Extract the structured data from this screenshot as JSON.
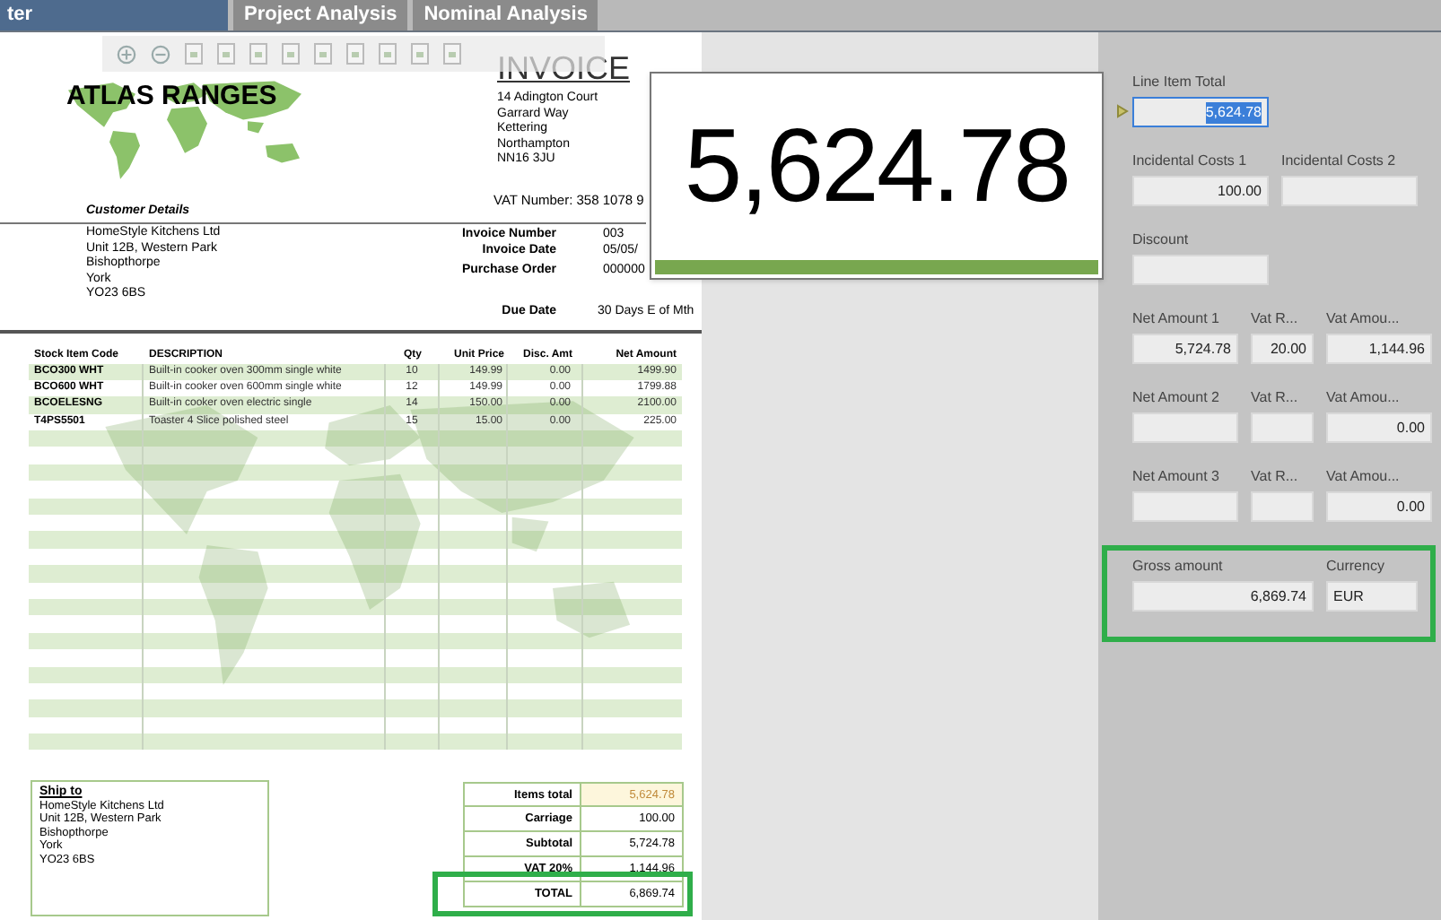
{
  "tabs": [
    {
      "label": "ter",
      "selected": true
    },
    {
      "label": "Project Analysis",
      "selected": false
    },
    {
      "label": "Nominal Analysis",
      "selected": false
    }
  ],
  "invoice": {
    "company": "ATLAS RANGES",
    "title": "INVOICE",
    "address": [
      "14 Adington Court",
      "Garrard Way",
      "Kettering",
      "Northampton",
      "NN16 3JU"
    ],
    "vat_number": "VAT Number: 358 1078 9",
    "customer_heading": "Customer Details",
    "customer": [
      "HomeStyle Kitchens Ltd",
      "Unit 12B, Western Park",
      "Bishopthorpe",
      "York",
      "YO23 6BS"
    ],
    "meta": [
      {
        "label": "Invoice Number",
        "value": "003"
      },
      {
        "label": "Invoice Date",
        "value": "05/05/"
      },
      {
        "label": "Purchase Order",
        "value": "000000"
      }
    ],
    "due_date": {
      "label": "Due Date",
      "value": "30 Days E of Mth"
    },
    "columns": [
      "Stock Item Code",
      "DESCRIPTION",
      "Qty",
      "Unit Price",
      "Disc. Amt",
      "Net Amount"
    ],
    "rows": [
      [
        "BCO300 WHT",
        "Built-in cooker oven 300mm single white",
        "10",
        "149.99",
        "0.00",
        "1499.90"
      ],
      [
        "BCO600 WHT",
        "Built-in cooker oven 600mm single white",
        "12",
        "149.99",
        "0.00",
        "1799.88"
      ],
      [
        "BCOELESNG",
        "Built-in cooker oven electric single",
        "14",
        "150.00",
        "0.00",
        "2100.00"
      ],
      [
        "T4PS5501",
        "Toaster 4 Slice polished steel",
        "15",
        "15.00",
        "0.00",
        "225.00"
      ]
    ],
    "ship_to_heading": "Ship to",
    "ship_to": [
      "HomeStyle Kitchens Ltd",
      "Unit 12B, Western Park",
      "Bishopthorpe",
      "York",
      "YO23 6BS"
    ],
    "totals": [
      {
        "label": "Items total",
        "value": "5,624.78",
        "highlighted": false,
        "selected": true
      },
      {
        "label": "Carriage",
        "value": "100.00",
        "highlighted": false,
        "selected": false
      },
      {
        "label": "Subtotal",
        "value": "5,724.78",
        "highlighted": false,
        "selected": false
      },
      {
        "label": "VAT 20%",
        "value": "1,144.96",
        "highlighted": false,
        "selected": false
      },
      {
        "label": "TOTAL",
        "value": "6,869.74",
        "highlighted": true,
        "selected": false
      }
    ]
  },
  "popup": {
    "value": "5,624.78"
  },
  "panel": {
    "rows": [
      {
        "fields": [
          {
            "label": "Line Item Total",
            "value": "5,624.78",
            "selected": true
          }
        ]
      },
      {
        "fields": [
          {
            "label": "Incidental Costs 1",
            "value": "100.00",
            "selected": false
          },
          {
            "label": "Incidental Costs 2",
            "selected": false
          }
        ]
      },
      {
        "fields": [
          {
            "label": "Discount",
            "selected": false
          }
        ]
      },
      {
        "fields": [
          {
            "label": "Net Amount 1",
            "value": "5,724.78",
            "selected": false
          },
          {
            "label": "Vat R...",
            "value": "20.00",
            "selected": false
          },
          {
            "label": "Vat Amou...",
            "value": "1,144.96",
            "selected": false
          }
        ]
      },
      {
        "fields": [
          {
            "label": "Net Amount 2",
            "selected": false
          },
          {
            "label": "Vat R...",
            "selected": false
          },
          {
            "label": "Vat Amou...",
            "value": "0.00",
            "selected": false
          }
        ]
      },
      {
        "fields": [
          {
            "label": "Net Amount 3",
            "selected": false
          },
          {
            "label": "Vat R...",
            "selected": false
          },
          {
            "label": "Vat Amou...",
            "value": "0.00",
            "selected": false
          }
        ]
      },
      {
        "kind": "highlight_box",
        "fields": [
          {
            "label": "Gross amount",
            "value": "6,869.74",
            "selected": false
          },
          {
            "label": "Currency",
            "value": "EUR",
            "selected": false
          }
        ]
      }
    ]
  }
}
